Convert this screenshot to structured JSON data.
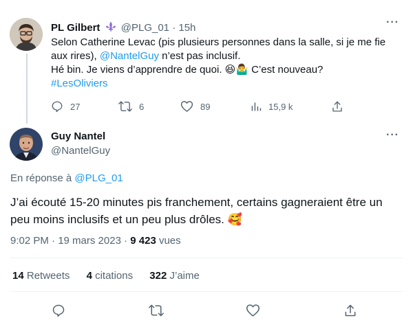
{
  "tweet1": {
    "author_name": "PL Gilbert",
    "badge_icon": "fleur-de-lis-icon",
    "handle": "@PLG_01",
    "separator": "·",
    "time": "15h",
    "body": {
      "line1": "Selon Catherine Levac (pis plusieurs personnes dans la salle, si je me fie",
      "line2_pre": "aux rires), ",
      "line2_mention": "@NantelGuy",
      "line2_post": " n’est pas inclusif.",
      "line3": "Hé bin. Je viens d’apprendre de quoi. 😆🤷‍♂️  C’est nouveau?",
      "hashtag": "#LesOliviers"
    },
    "actions": {
      "replies": "27",
      "retweets": "6",
      "likes": "89",
      "views": "15,9 k"
    }
  },
  "tweet2": {
    "author_name": "Guy Nantel",
    "handle": "@NantelGuy",
    "reply_prefix": "En réponse à ",
    "reply_to": "@PLG_01",
    "body": {
      "line1": "J’ai écouté 15-20 minutes pis franchement, certains gagneraient être un",
      "line2": "peu moins inclusifs et un peu plus drôles. 🥰"
    },
    "timestamp": "9:02 PM · 19 mars 2023 · ",
    "views_count": "9 423",
    "views_label": " vues",
    "stats": {
      "retweets_count": "14",
      "retweets_label": " Retweets",
      "quotes_count": "4",
      "quotes_label": " citations",
      "likes_count": "322",
      "likes_label": " J’aime"
    }
  },
  "colors": {
    "accent": "#1d9bf0",
    "text": "#0f1419",
    "muted": "#536471",
    "divider": "#eff3f4",
    "thread_line": "#cfd9de"
  }
}
